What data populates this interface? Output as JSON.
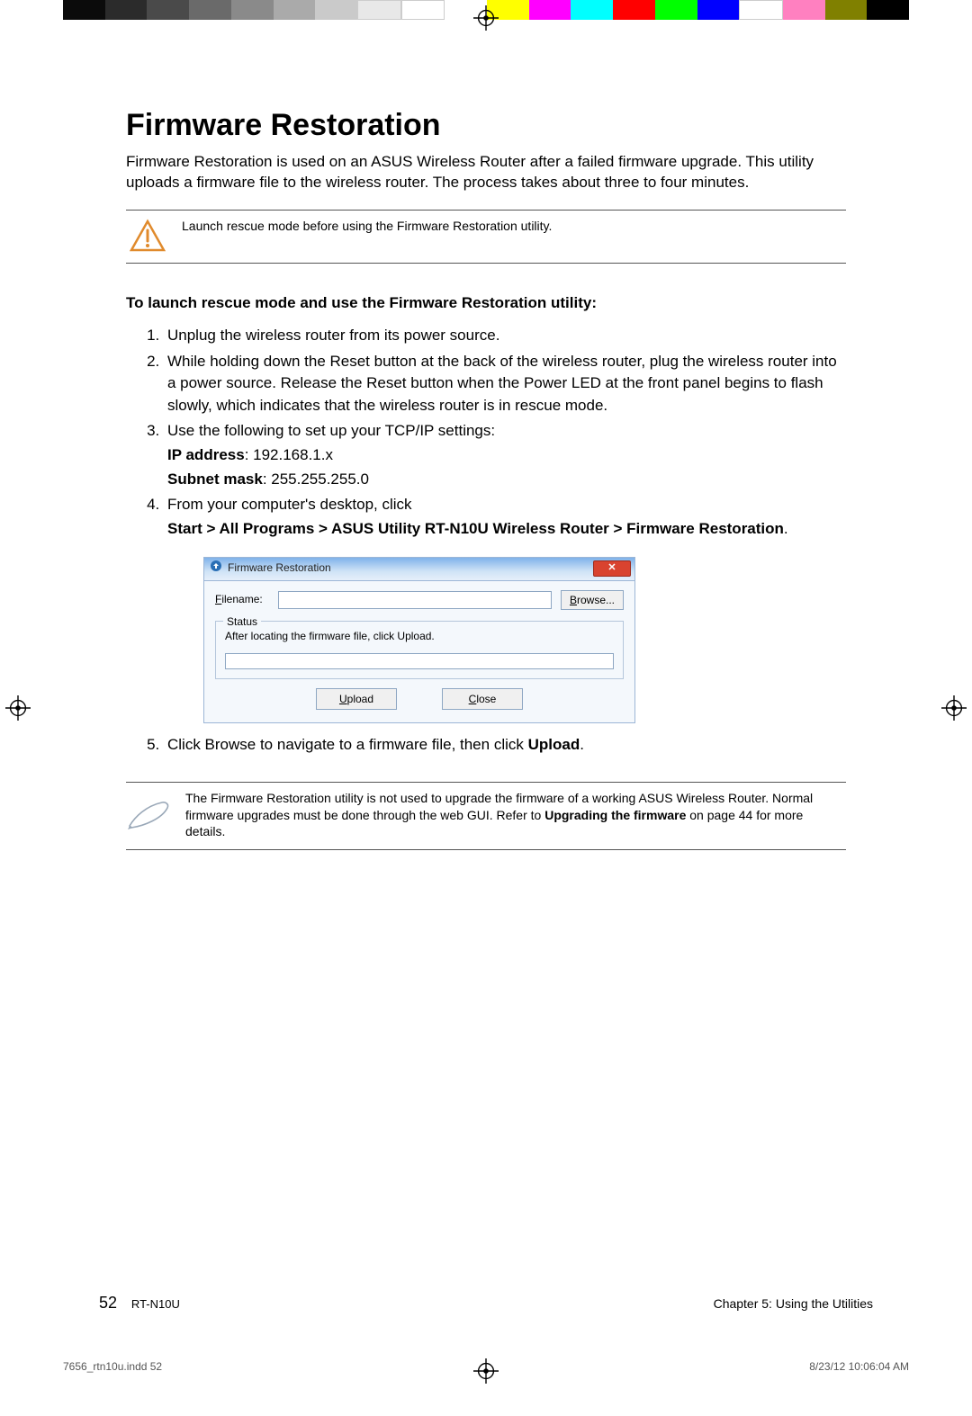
{
  "heading": "Firmware Restoration",
  "intro": "Firmware Restoration is used on an ASUS Wireless Router after a failed firmware upgrade. This utility uploads a firmware file to the wireless router. The process takes about three to four minutes.",
  "note1": "Launch rescue mode before using the Firmware Restoration utility.",
  "subhead": "To launch rescue mode and use the Firmware Restoration utility:",
  "steps": {
    "s1": "Unplug the wireless router from its power source.",
    "s2": "While holding down the Reset button at the back of the wireless router, plug the wireless router into a power source. Release the Reset button when the Power LED at the front panel begins to flash slowly, which indicates that the wireless router is in rescue mode.",
    "s3": "Use the following to set up your TCP/IP settings:",
    "ip_label": "IP address",
    "ip_value": ": 192.168.1.x",
    "mask_label": "Subnet mask",
    "mask_value": ": 255.255.255.0",
    "s4": "From your computer's desktop, click",
    "s4b": "Start > All Programs > ASUS Utility RT-N10U Wireless Router > Firmware Restoration",
    "s4c": ".",
    "s5a": "Click Browse to navigate to a firmware file, then click ",
    "s5b": "Upload",
    "s5c": "."
  },
  "dialog": {
    "title": "Firmware Restoration",
    "filename_label": "Filename:",
    "browse": "Browse...",
    "status_legend": "Status",
    "status_text": "After locating the firmware file, click Upload.",
    "upload": "Upload",
    "close": "Close"
  },
  "note2a": "The Firmware Restoration utility is not used to upgrade the firmware of a working ASUS Wireless Router. Normal firmware upgrades must be done through the web GUI. Refer to ",
  "note2b": "Upgrading the firmware",
  "note2c": " on page 44 for more details.",
  "footer": {
    "page": "52",
    "model": "RT-N10U",
    "chapter": "Chapter 5: Using the Utilities"
  },
  "slug": {
    "file": "7656_rtn10u.indd   52",
    "stamp": "8/23/12   10:06:04 AM"
  },
  "colorbar": [
    "#0b0b0b",
    "#2b2b2b",
    "#4a4a4a",
    "#6a6a6a",
    "#8a8a8a",
    "#aaaaaa",
    "#cacaca",
    "#e8e8e8",
    "#ffffff",
    "",
    "#ffff00",
    "#ff00ff",
    "#00ffff",
    "#ff0000",
    "#00ff00",
    "#0000ff",
    "#ffffff",
    "#ff80c0",
    "#808000",
    "#000000"
  ]
}
